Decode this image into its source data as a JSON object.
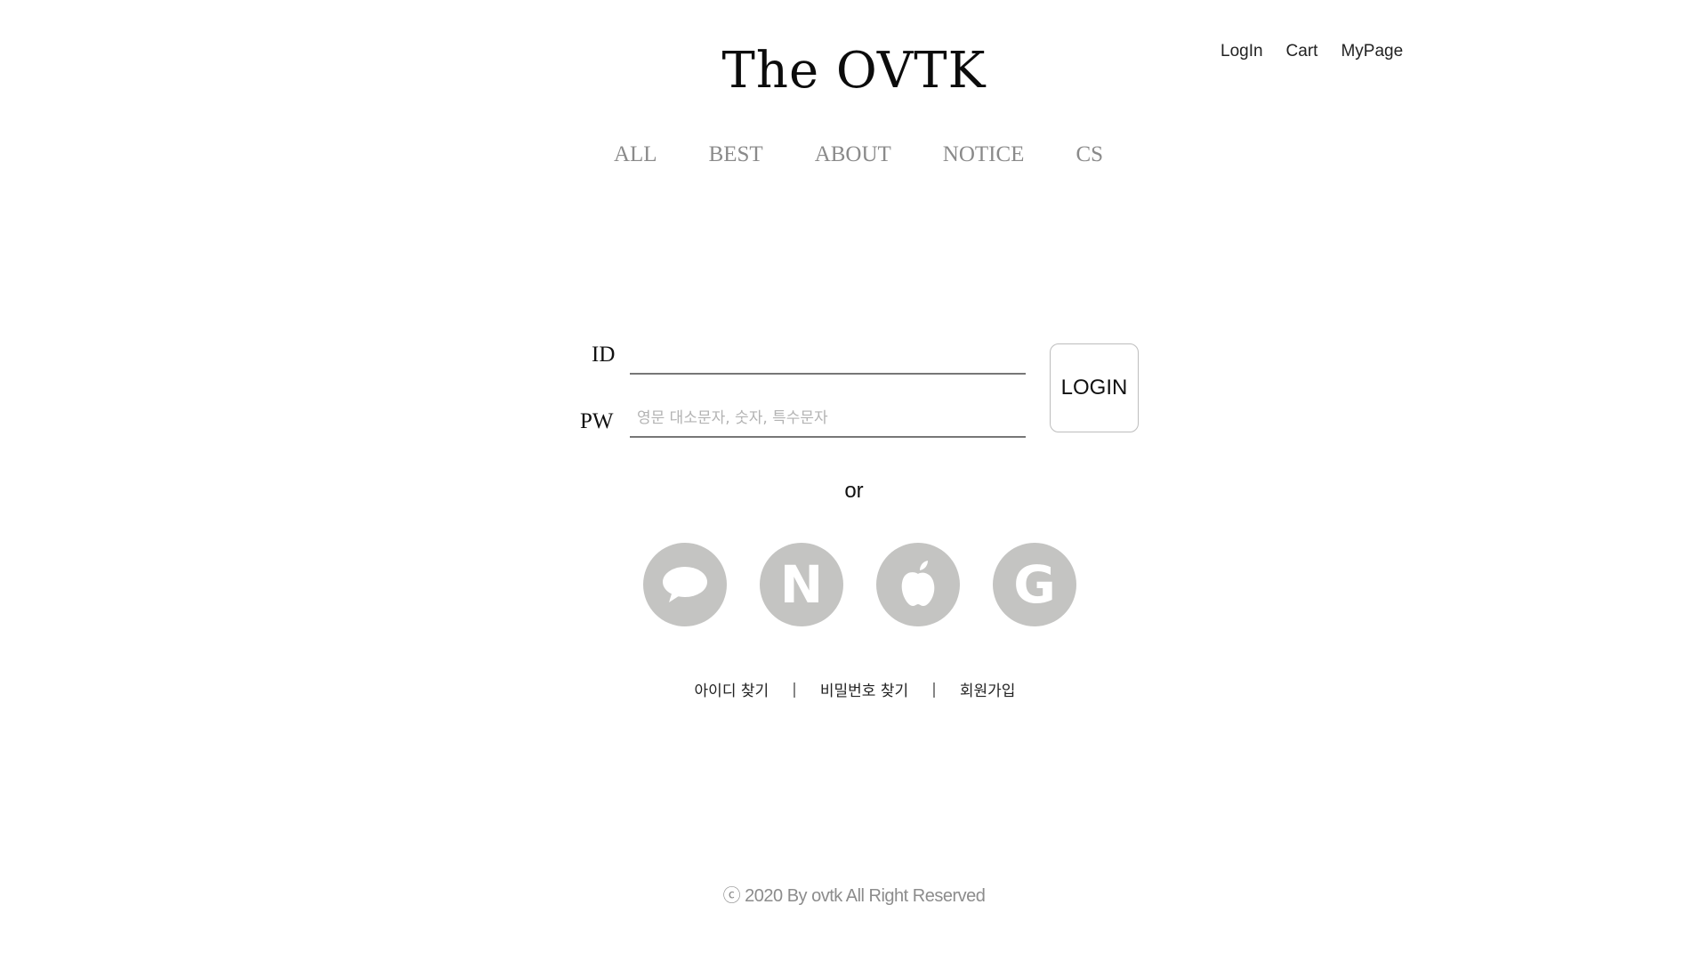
{
  "brand": {
    "title": "The OVTK"
  },
  "util_nav": {
    "login": "LogIn",
    "cart": "Cart",
    "mypage": "MyPage"
  },
  "main_nav": {
    "all": "ALL",
    "best": "BEST",
    "about": "ABOUT",
    "notice": "NOTICE",
    "cs": "CS"
  },
  "login_form": {
    "id_label": "ID",
    "id_value": "",
    "pw_label": "PW",
    "pw_placeholder": "영문 대소문자, 숫자, 특수문자",
    "login_button": "LOGIN"
  },
  "or_text": "or",
  "social": {
    "kakao_icon": "speech-bubble",
    "naver_letter": "N",
    "apple_icon": "apple",
    "google_letter": "G",
    "icon_bg_color": "#c4c4c2",
    "icon_fg_color": "#ffffff"
  },
  "account_links": {
    "find_id": "아이디 찾기",
    "separator": "|",
    "find_pw": "비밀번호 찾기",
    "signup": "회원가입"
  },
  "footer": {
    "copyright": "ⓒ 2020 By ovtk All Right Reserved"
  }
}
